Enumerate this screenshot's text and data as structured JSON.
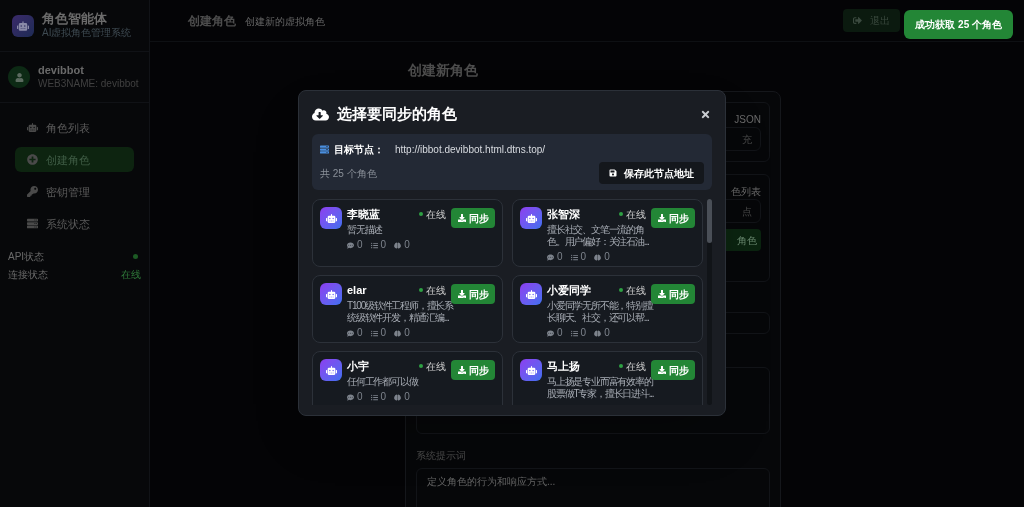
{
  "sidebar": {
    "app_title": "角色智能体",
    "app_subtitle": "AI虚拟角色管理系统",
    "user": {
      "name": "devibbot",
      "handle": "WEB3NAME: devibbot"
    },
    "nav": [
      {
        "label": "角色列表",
        "selected": false
      },
      {
        "label": "创建角色",
        "selected": true
      },
      {
        "label": "密钥管理",
        "selected": false
      },
      {
        "label": "系统状态",
        "selected": false
      }
    ],
    "status": [
      {
        "label": "API状态",
        "kind": "dot",
        "online": true
      },
      {
        "label": "连接状态",
        "kind": "text",
        "value": "在线"
      }
    ]
  },
  "header": {
    "title": "创建角色",
    "subtitle": "创建新的虚拟角色",
    "logout": "退出"
  },
  "form": {
    "title": "创建新角色",
    "import_label_tail": "JSON",
    "import_input_tail": "充",
    "node_label_tail": "色列表",
    "node_input_tail": "点",
    "fetch_button_tail": "角色",
    "prompt_label": "系统提示词",
    "prompt_placeholder": "定义角色的行为和响应方式..."
  },
  "toast": "成功获取 25 个角色",
  "modal": {
    "title": "选择要同步的角色",
    "node_label": "目标节点：",
    "node_url": "http://ibbot.devibbot.html.dtns.top/",
    "count": "共 25 个角色",
    "save_button": "保存此节点地址",
    "characters": [
      {
        "name": "李晓蓝",
        "online": true,
        "status": "在线",
        "description": [
          "暂无描述"
        ],
        "stats": [
          "0",
          "0",
          "0"
        ],
        "button": "同步"
      },
      {
        "name": "张智深",
        "online": true,
        "status": "在线",
        "description": [
          "擅长社交、文笔一流的角",
          "色。用户偏好：关注石油..."
        ],
        "stats": [
          "0",
          "0",
          "0"
        ],
        "button": "同步"
      },
      {
        "name": "elar",
        "online": true,
        "status": "在线",
        "description": [
          "T100级软件工程师，擅长系",
          "统级软件开发，精通汇编..."
        ],
        "stats": [
          "0",
          "0",
          "0"
        ],
        "button": "同步"
      },
      {
        "name": "小爱同学",
        "online": true,
        "status": "在线",
        "description": [
          "小爱同学无所不能，特别擅",
          "长聊天、社交，还可以帮..."
        ],
        "stats": [
          "0",
          "0",
          "0"
        ],
        "button": "同步"
      },
      {
        "name": "小宇",
        "online": true,
        "status": "在线",
        "description": [
          "任何工作都可以做"
        ],
        "stats": [
          "0",
          "0",
          "0"
        ],
        "button": "同步"
      },
      {
        "name": "马上扬",
        "online": true,
        "status": "在线",
        "description": [
          "马上扬是专业而富有效率的",
          "股票做T专家，擅长日进斗..."
        ],
        "button": "同步"
      }
    ]
  }
}
